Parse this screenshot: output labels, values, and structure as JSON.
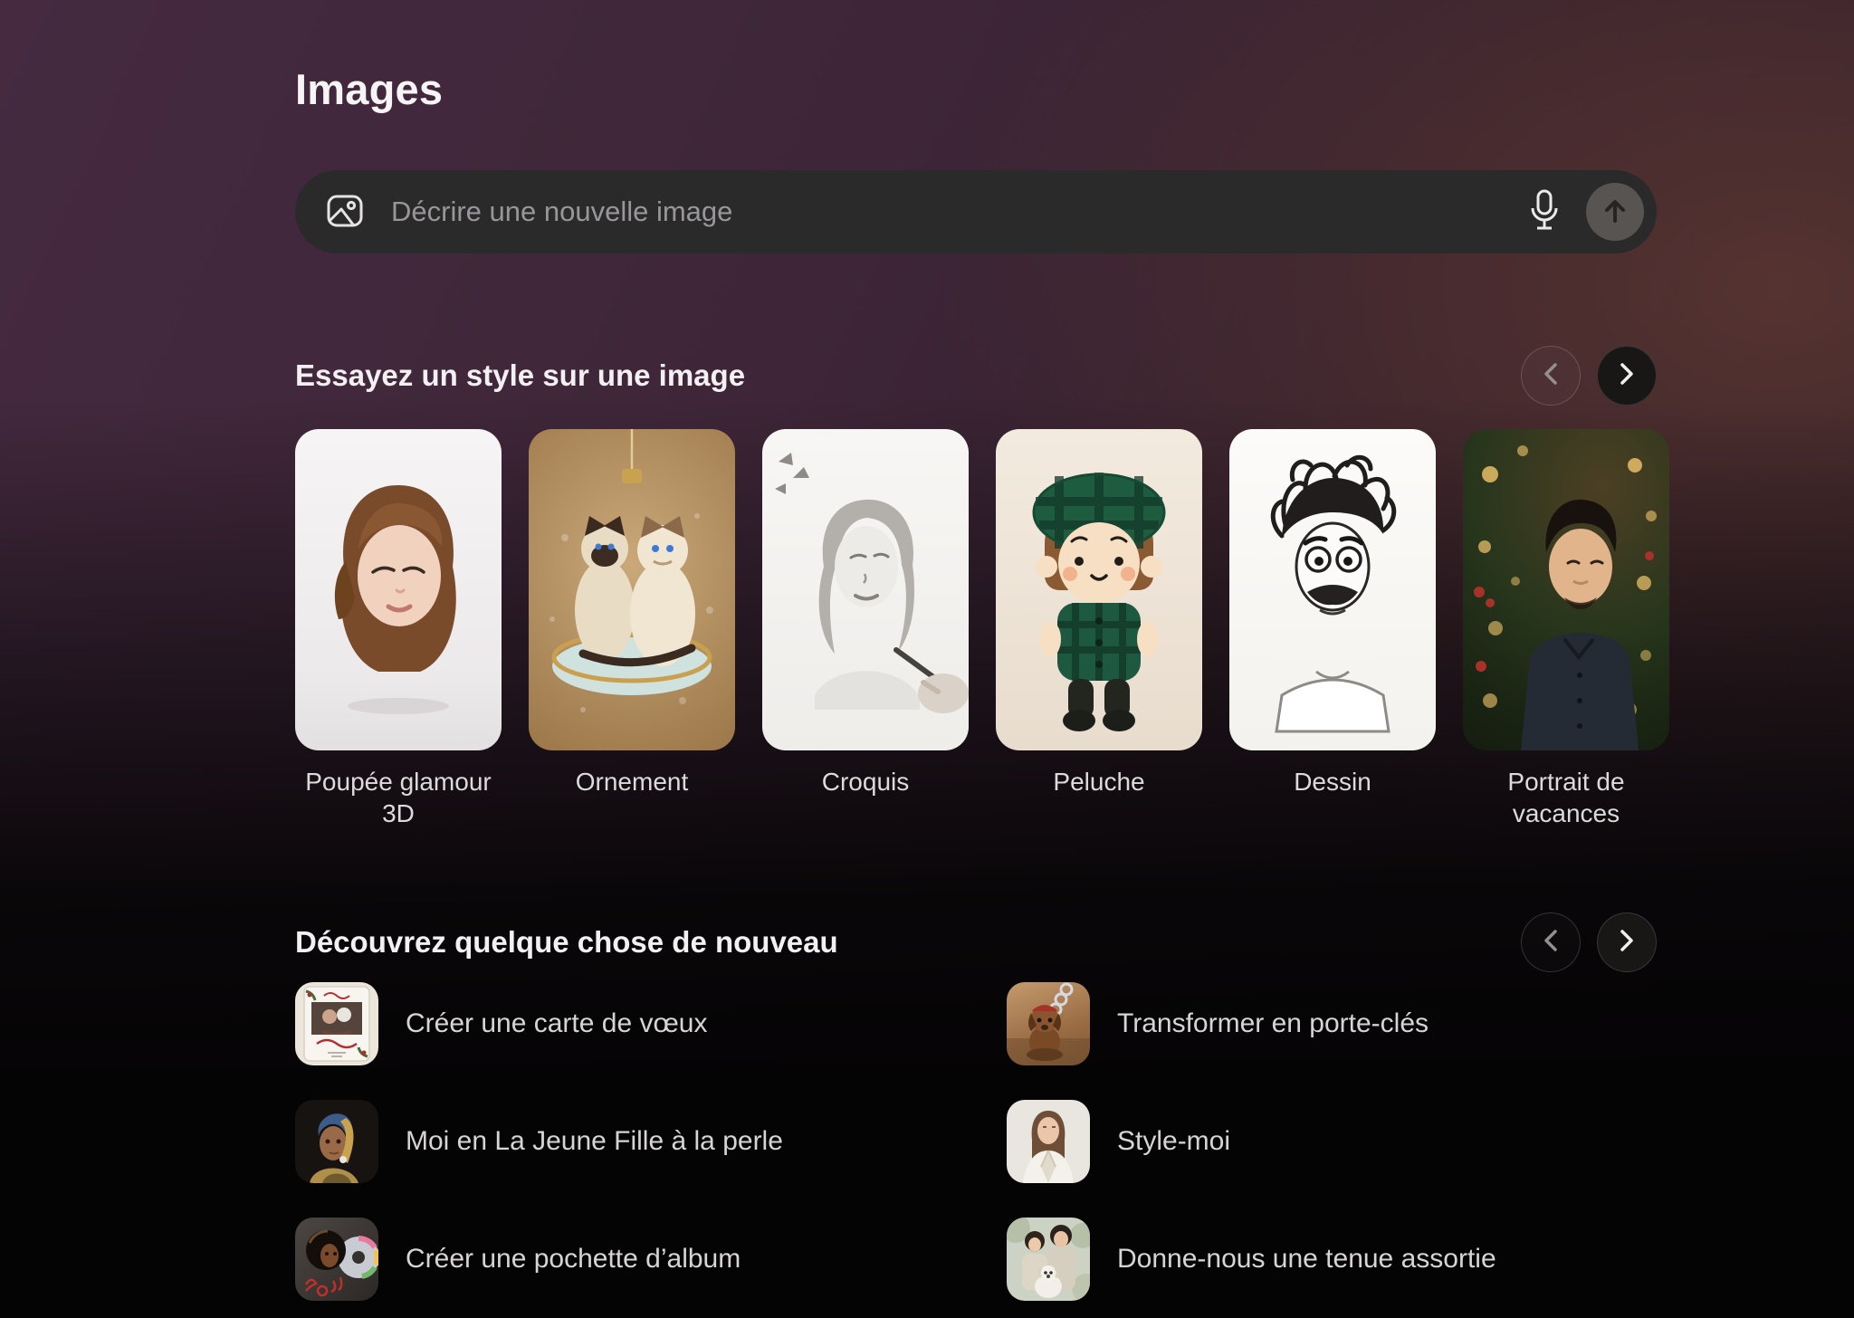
{
  "page": {
    "title": "Images"
  },
  "search": {
    "placeholder": "Décrire une nouvelle image",
    "left_icon": "image-icon",
    "right_icons": [
      "microphone-icon",
      "arrow-up-icon"
    ]
  },
  "styles_section": {
    "title": "Essayez un style sur une image",
    "nav": {
      "prev_icon": "chevron-left-icon",
      "next_icon": "chevron-right-icon"
    },
    "cards": [
      {
        "label": "Poupée glamour 3D"
      },
      {
        "label": "Ornement"
      },
      {
        "label": "Croquis"
      },
      {
        "label": "Peluche"
      },
      {
        "label": "Dessin"
      },
      {
        "label": "Portrait de vacances"
      }
    ]
  },
  "discover_section": {
    "title": "Découvrez quelque chose de nouveau",
    "nav": {
      "prev_icon": "chevron-left-icon",
      "next_icon": "chevron-right-icon"
    },
    "items": [
      {
        "label": "Créer une carte de vœux"
      },
      {
        "label": "Transformer en porte-clés"
      },
      {
        "label": "Moi en La Jeune Fille à la perle"
      },
      {
        "label": "Style-moi"
      },
      {
        "label": "Créer une pochette d’album"
      },
      {
        "label": "Donne-nous une tenue assortie"
      }
    ]
  },
  "colors": {
    "background_top_left": "#452a40",
    "background_top_right": "#553330",
    "background_bottom": "#050405",
    "prompt_bar": "#2b2a2a",
    "prompt_placeholder": "#99969a",
    "send_button": "#575451",
    "text_primary": "#f3f0f2",
    "text_secondary": "#d6d4d5"
  }
}
